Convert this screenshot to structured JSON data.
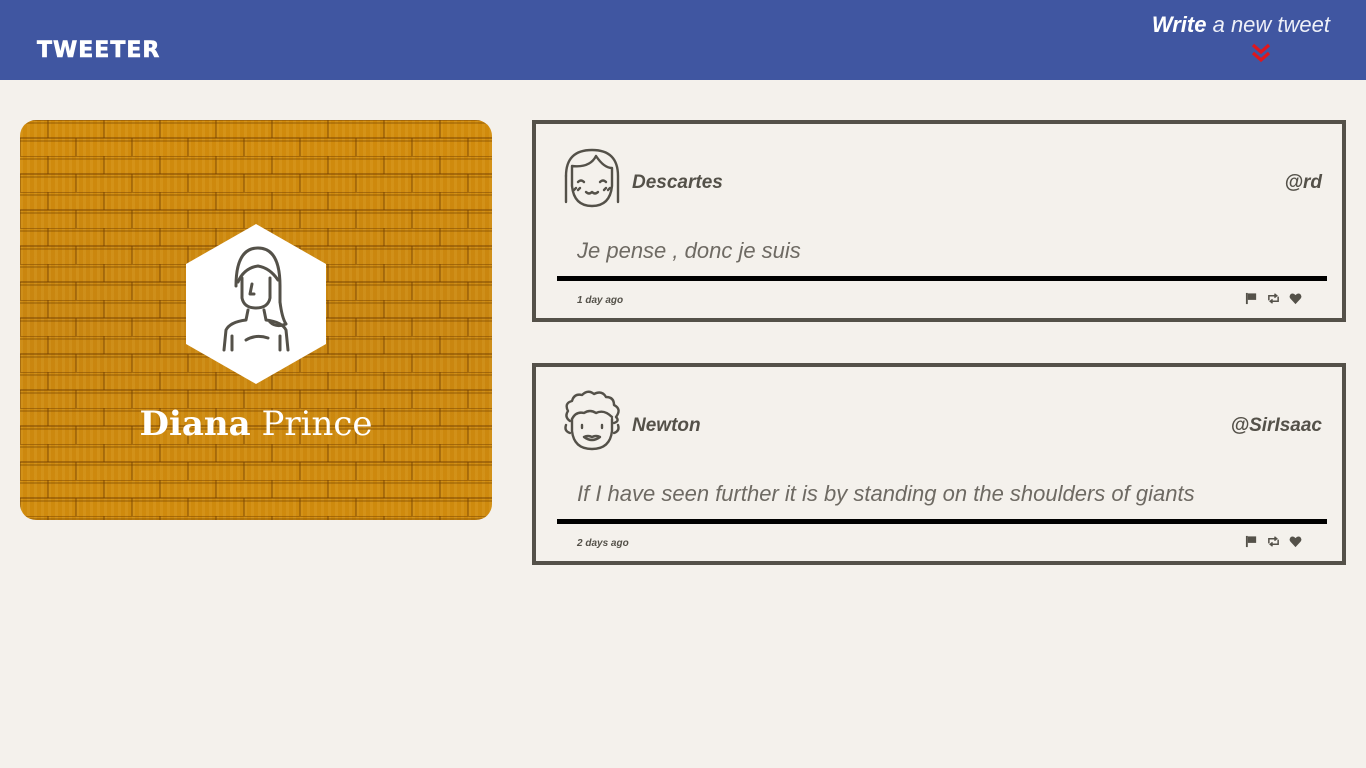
{
  "nav": {
    "brand": "TWEETER",
    "compose_bold": "Write",
    "compose_rest": " a new tweet",
    "compose_icon": "double-chevron-down-icon",
    "accent_color": "#e0161d",
    "background_color": "#4056a1"
  },
  "profile": {
    "first_name": "Diana",
    "last_name": " Prince",
    "avatar_icon": "woman-avatar-icon",
    "background_color": "#c8850e"
  },
  "tweets": [
    {
      "author": "Descartes",
      "handle": "@rd",
      "content": "Je pense , donc je suis",
      "time": "1 day ago",
      "avatar_icon": "girl-avatar-icon",
      "actions": [
        "flag-icon",
        "retweet-icon",
        "heart-icon"
      ]
    },
    {
      "author": "Newton",
      "handle": "@SirIsaac",
      "content": "If I have seen further it is by standing on the shoulders of giants",
      "time": "2 days ago",
      "avatar_icon": "curly-hair-avatar-icon",
      "actions": [
        "flag-icon",
        "retweet-icon",
        "heart-icon"
      ]
    }
  ]
}
